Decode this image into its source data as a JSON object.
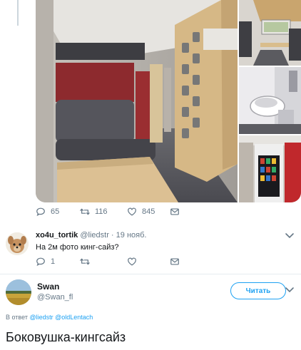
{
  "top_tweet": {
    "actions": {
      "reply_count": "65",
      "retweet_count": "116",
      "like_count": "845"
    }
  },
  "reply": {
    "username": "xo4u_tortik",
    "handle": "@liedstr",
    "separator": " · ",
    "date": "19 нояб.",
    "text": "На 2м фото кинг-сайз?",
    "reply_count": "1"
  },
  "main_tweet": {
    "name": "Swan",
    "handle": "@Swan_fl",
    "follow_label": "Читать",
    "replying_prefix": "В ответ ",
    "replying_to_1": "@liedstr",
    "replying_to_2": "@oldLentach",
    "text": "Боковушка-кингсайз"
  },
  "colors": {
    "accent": "#1da1f2",
    "muted": "#657786",
    "text": "#14171a",
    "divider": "#e6ecf0"
  },
  "icons": [
    "chevron-down-icon",
    "reply-icon",
    "retweet-icon",
    "like-icon",
    "dm-icon"
  ]
}
